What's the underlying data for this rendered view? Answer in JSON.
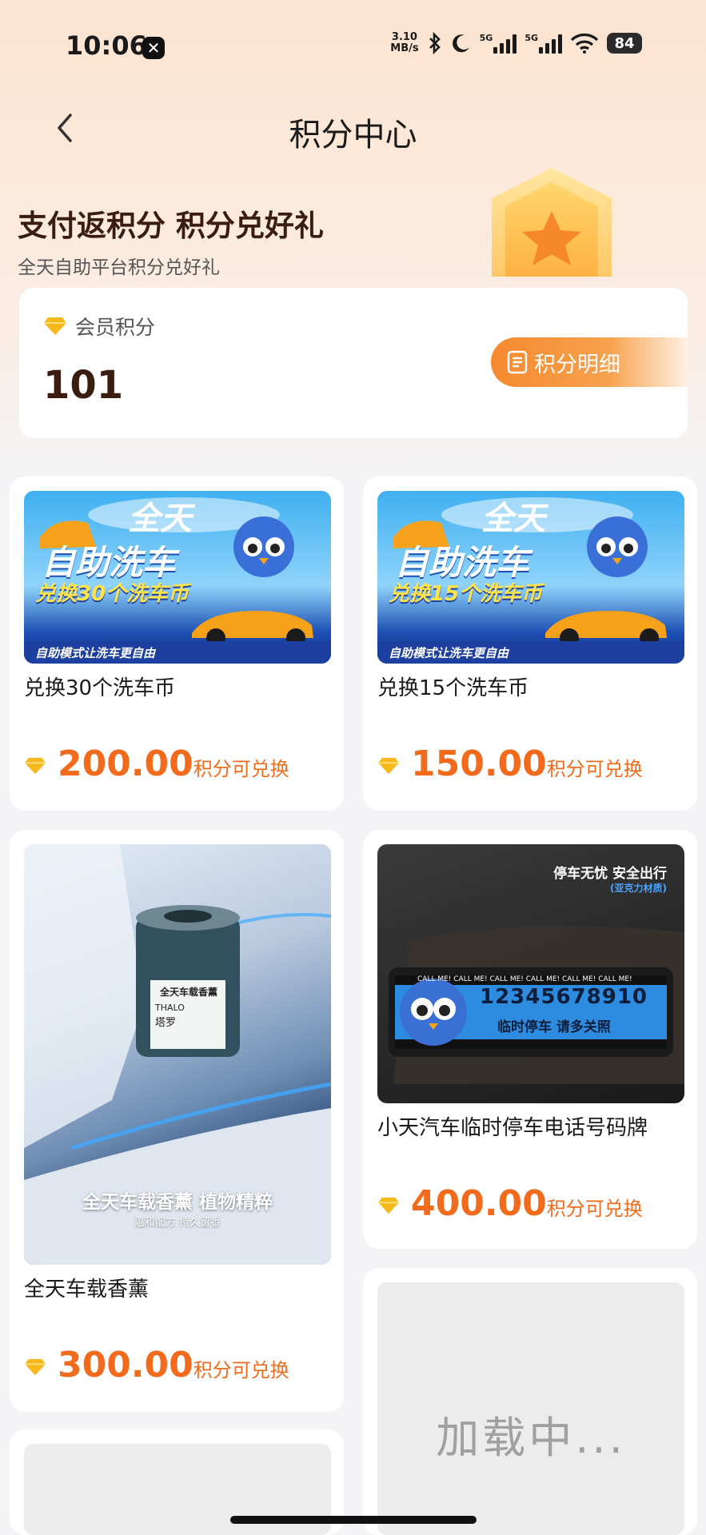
{
  "status_bar": {
    "time": "10:06",
    "x_badge": "✕",
    "net_speed_value": "3.10",
    "net_speed_unit": "MB/s",
    "sim1": "5G",
    "sim2": "5G",
    "battery": "84"
  },
  "nav": {
    "title": "积分中心"
  },
  "hero": {
    "slogan": "支付返积分 积分兑好礼",
    "subtitle": "全天自助平台积分兑好礼"
  },
  "points_card": {
    "label": "会员积分",
    "value": "101",
    "detail_button": "积分明细"
  },
  "products": [
    {
      "name": "兑换30个洗车币",
      "price": "200.00",
      "suffix": "积分可兑换",
      "banner_title_1": "全天",
      "banner_title_2": "自助洗车",
      "banner_sub": "兑换30个洗车币",
      "banner_foot": "自助模式让洗车更自由"
    },
    {
      "name": "兑换15个洗车币",
      "price": "150.00",
      "suffix": "积分可兑换",
      "banner_title_1": "全天",
      "banner_title_2": "自助洗车",
      "banner_sub": "兑换15个洗车币",
      "banner_foot": "自助模式让洗车更自由"
    },
    {
      "name": "全天车载香薰",
      "price": "300.00",
      "suffix": "积分可兑换",
      "img_label": "全天车载香薰",
      "img_brand": "THALO",
      "img_brand_cn": "塔罗",
      "img_caption": "全天车载香薰  植物精粹",
      "img_caption_sub": "温和配方 持久留香"
    },
    {
      "name": "小天汽车临时停车电话号码牌",
      "price": "400.00",
      "suffix": "积分可兑换",
      "img_head": "停车无忧  安全出行",
      "img_head_sub": "(亚克力材质)",
      "img_number": "12345678910",
      "img_note": "临时停车  请多关照",
      "img_tape": "CALL ME! CALL ME! CALL ME! CALL ME! CALL ME! CALL ME!"
    }
  ],
  "loading_text": "加载中...",
  "colors": {
    "accent": "#f26b1d",
    "button_gradient_start": "#f6892f",
    "points_text": "#3a1d0f",
    "diamond": "#f6b81a"
  },
  "icons": [
    "back-chevron-icon",
    "diamond-icon",
    "list-doc-icon",
    "star-medal-icon",
    "bluetooth-icon",
    "moon-icon",
    "wifi-icon",
    "signal-icon",
    "battery-icon"
  ]
}
